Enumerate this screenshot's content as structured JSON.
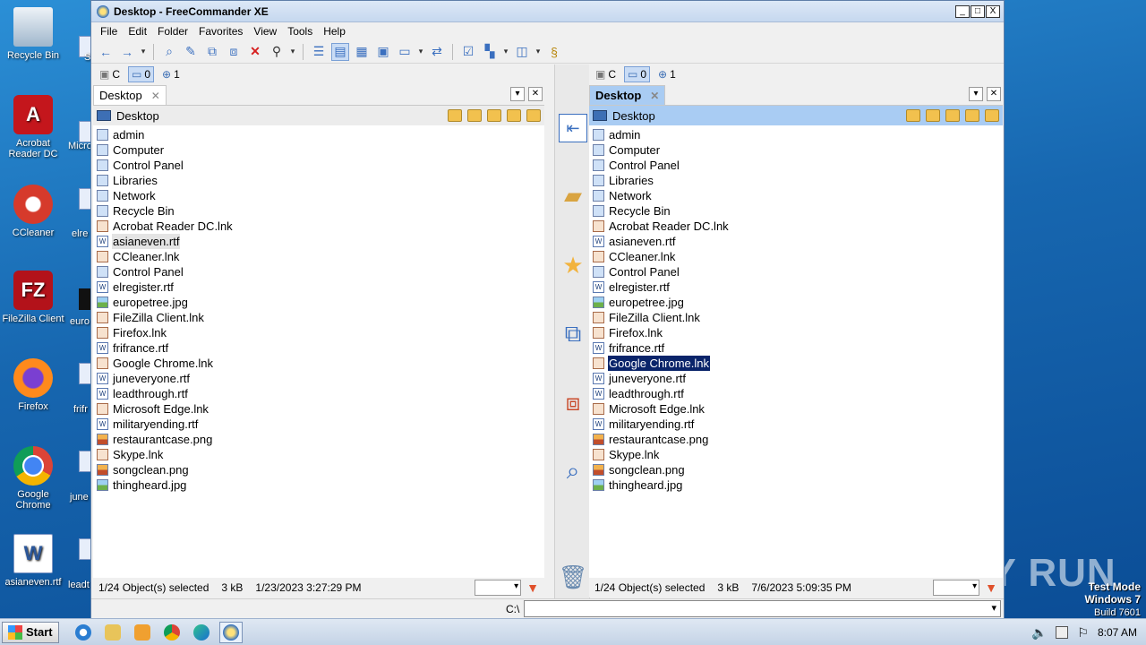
{
  "desktop": {
    "icons": [
      {
        "label": "Recycle Bin",
        "icon": "recycle-bin-icon"
      },
      {
        "label": "Acrobat Reader DC",
        "icon": "acrobat-icon"
      },
      {
        "label": "CCleaner",
        "icon": "ccleaner-icon"
      },
      {
        "label": "FileZilla Client",
        "icon": "filezilla-icon"
      },
      {
        "label": "Firefox",
        "icon": "firefox-icon"
      },
      {
        "label": "Google Chrome",
        "icon": "chrome-icon"
      },
      {
        "label": "asianeven.rtf",
        "icon": "word-doc-icon"
      }
    ],
    "peek_labels": [
      "S",
      "Micro",
      "elre",
      "euro",
      "frifr",
      "june",
      "leadt"
    ],
    "watermark": {
      "line1": "Test Mode",
      "line2": "Windows 7",
      "line3": "Build 7601"
    },
    "brand": "ANY RUN"
  },
  "window": {
    "title": "Desktop - FreeCommander XE",
    "buttons": {
      "minimize": "_",
      "maximize": "□",
      "close": "X"
    },
    "menu": [
      "File",
      "Edit",
      "Folder",
      "Favorites",
      "View",
      "Tools",
      "Help"
    ],
    "cmd_label": "C:\\"
  },
  "left_pane": {
    "drives": {
      "c": "C",
      "desktop": "0",
      "net": "1"
    },
    "tab": "Desktop",
    "path": "Desktop",
    "items": [
      {
        "name": "admin",
        "type": "sys"
      },
      {
        "name": "Computer",
        "type": "sys"
      },
      {
        "name": "Control Panel",
        "type": "sys"
      },
      {
        "name": "Libraries",
        "type": "sys"
      },
      {
        "name": "Network",
        "type": "sys"
      },
      {
        "name": "Recycle Bin",
        "type": "sys"
      },
      {
        "name": "Acrobat Reader DC.lnk",
        "type": "lnk"
      },
      {
        "name": "asianeven.rtf",
        "type": "rtf"
      },
      {
        "name": "CCleaner.lnk",
        "type": "lnk"
      },
      {
        "name": "Control Panel",
        "type": "sys"
      },
      {
        "name": "elregister.rtf",
        "type": "rtf"
      },
      {
        "name": "europetree.jpg",
        "type": "img"
      },
      {
        "name": "FileZilla Client.lnk",
        "type": "lnk"
      },
      {
        "name": "Firefox.lnk",
        "type": "lnk"
      },
      {
        "name": "frifrance.rtf",
        "type": "rtf"
      },
      {
        "name": "Google Chrome.lnk",
        "type": "lnk"
      },
      {
        "name": "juneveryone.rtf",
        "type": "rtf"
      },
      {
        "name": "leadthrough.rtf",
        "type": "rtf"
      },
      {
        "name": "Microsoft Edge.lnk",
        "type": "lnk"
      },
      {
        "name": "militaryending.rtf",
        "type": "rtf"
      },
      {
        "name": "restaurantcase.png",
        "type": "png"
      },
      {
        "name": "Skype.lnk",
        "type": "lnk"
      },
      {
        "name": "songclean.png",
        "type": "png"
      },
      {
        "name": "thingheard.jpg",
        "type": "img"
      }
    ],
    "status": {
      "selected": "1/24 Object(s) selected",
      "size": "3 kB",
      "date": "1/23/2023 3:27:29 PM"
    }
  },
  "right_pane": {
    "drives": {
      "c": "C",
      "desktop": "0",
      "net": "1"
    },
    "tab": "Desktop",
    "path": "Desktop",
    "items": [
      {
        "name": "admin",
        "type": "sys"
      },
      {
        "name": "Computer",
        "type": "sys"
      },
      {
        "name": "Control Panel",
        "type": "sys"
      },
      {
        "name": "Libraries",
        "type": "sys"
      },
      {
        "name": "Network",
        "type": "sys"
      },
      {
        "name": "Recycle Bin",
        "type": "sys"
      },
      {
        "name": "Acrobat Reader DC.lnk",
        "type": "lnk"
      },
      {
        "name": "asianeven.rtf",
        "type": "rtf"
      },
      {
        "name": "CCleaner.lnk",
        "type": "lnk"
      },
      {
        "name": "Control Panel",
        "type": "sys"
      },
      {
        "name": "elregister.rtf",
        "type": "rtf"
      },
      {
        "name": "europetree.jpg",
        "type": "img"
      },
      {
        "name": "FileZilla Client.lnk",
        "type": "lnk"
      },
      {
        "name": "Firefox.lnk",
        "type": "lnk"
      },
      {
        "name": "frifrance.rtf",
        "type": "rtf"
      },
      {
        "name": "Google Chrome.lnk",
        "type": "lnk"
      },
      {
        "name": "juneveryone.rtf",
        "type": "rtf"
      },
      {
        "name": "leadthrough.rtf",
        "type": "rtf"
      },
      {
        "name": "Microsoft Edge.lnk",
        "type": "lnk"
      },
      {
        "name": "militaryending.rtf",
        "type": "rtf"
      },
      {
        "name": "restaurantcase.png",
        "type": "png"
      },
      {
        "name": "Skype.lnk",
        "type": "lnk"
      },
      {
        "name": "songclean.png",
        "type": "png"
      },
      {
        "name": "thingheard.jpg",
        "type": "img"
      }
    ],
    "status": {
      "selected": "1/24 Object(s) selected",
      "size": "3 kB",
      "date": "7/6/2023 5:09:35 PM"
    }
  },
  "taskbar": {
    "start": "Start",
    "clock": "8:07 AM"
  },
  "colors": {
    "selection": "#0a246a",
    "active_path": "#a9ccf3",
    "desktop": "#1767b0"
  }
}
